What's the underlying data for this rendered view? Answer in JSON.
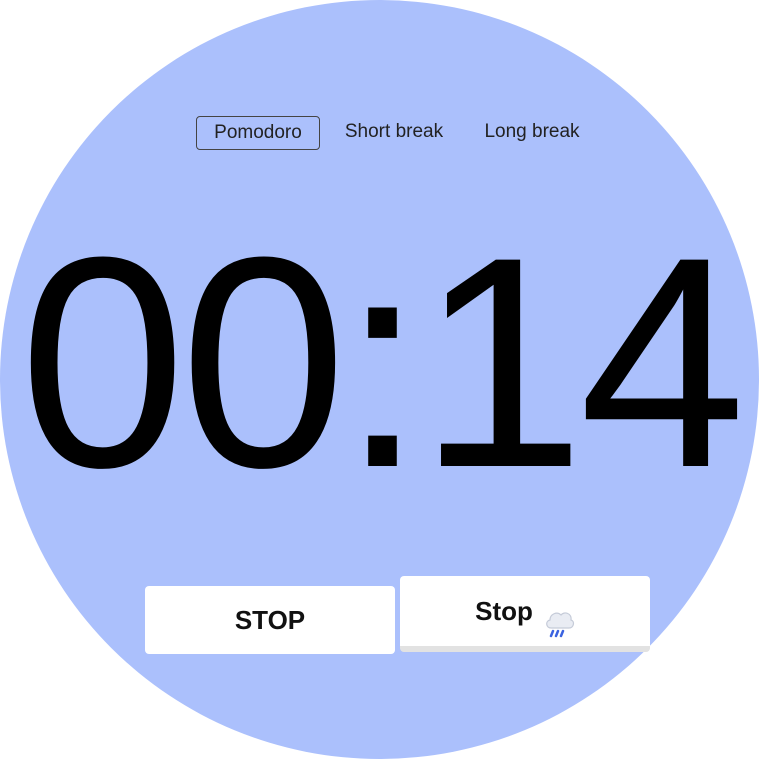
{
  "tabs": [
    {
      "label": "Pomodoro",
      "active": true
    },
    {
      "label": "Short break",
      "active": false
    },
    {
      "label": "Long break",
      "active": false
    }
  ],
  "timer": {
    "display": "00:14"
  },
  "buttons": {
    "primary_label": "STOP",
    "secondary_label": "Stop",
    "secondary_icon": "rain-cloud-icon"
  },
  "colors": {
    "background_circle": "#abc0fc",
    "button_bg": "#ffffff"
  }
}
